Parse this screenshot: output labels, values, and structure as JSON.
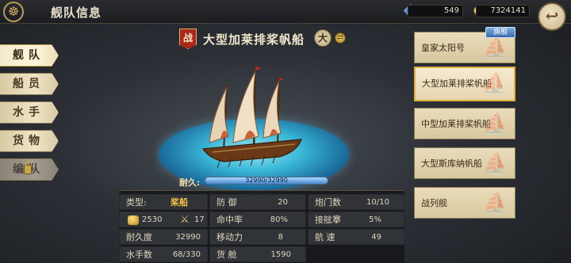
{
  "header": {
    "title": "舰队信息",
    "gems": "549",
    "gold": "7324141"
  },
  "tabs": [
    {
      "label": "舰队",
      "state": "active"
    },
    {
      "label": "船员",
      "state": "normal"
    },
    {
      "label": "水手",
      "state": "normal"
    },
    {
      "label": "货物",
      "state": "normal"
    },
    {
      "label": "编队",
      "state": "locked"
    }
  ],
  "ship": {
    "battle_badge": "战",
    "name": "大型加莱排桨帆船",
    "size_badge": "大",
    "durability_label": "耐久:",
    "durability_text": "32990/32990",
    "durability_fraction": 1.0
  },
  "stats": {
    "type_label": "类型:",
    "type_value": "桨船",
    "cargo_icon_value": "2530",
    "attack_icon_value": "17",
    "durability_label": "耐久度",
    "durability_value": "32990",
    "sailors_label": "水手数",
    "sailors_value": "68/330",
    "defense_label": "防 御",
    "defense_value": "20",
    "accuracy_label": "命中率",
    "accuracy_value": "80%",
    "mobility_label": "移动力",
    "mobility_value": "8",
    "hold_label": "货 舱",
    "hold_value": "1590",
    "gun_ports_label": "炮门数",
    "gun_ports_value": "10/10",
    "boarding_label": "接舷搴",
    "boarding_value": "5%",
    "speed_label": "航 速",
    "speed_value": "49"
  },
  "ship_list": [
    {
      "name": "皇家太阳号",
      "flagship": true,
      "selected": false
    },
    {
      "name": "大型加莱排桨帆船",
      "flagship": false,
      "selected": true
    },
    {
      "name": "中型加莱排桨帆船",
      "flagship": false,
      "selected": false
    },
    {
      "name": "大型斯库纳帆船",
      "flagship": false,
      "selected": false
    },
    {
      "name": "战列舰",
      "flagship": false,
      "selected": false
    }
  ],
  "flagship_tag": "旗舰",
  "colors": {
    "accent_gold": "#c9a84a",
    "sea": "#3ab8d8",
    "battle_red": "#a8281c"
  }
}
